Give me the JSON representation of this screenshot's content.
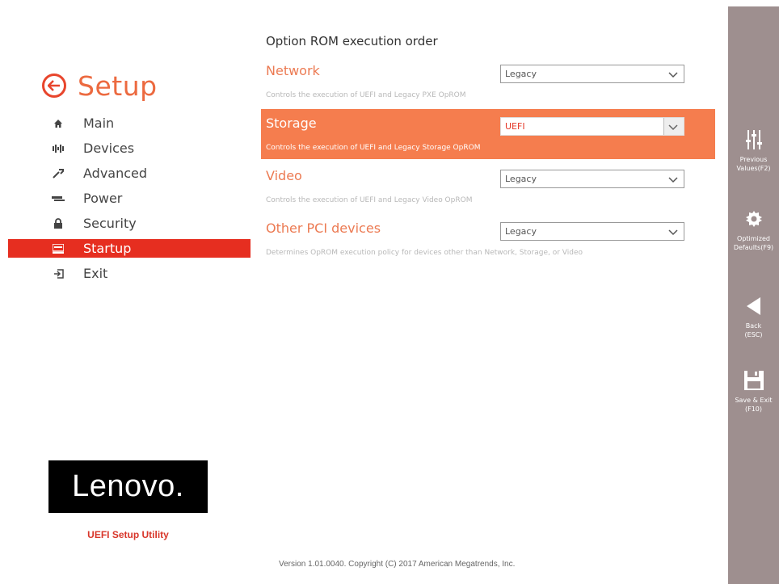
{
  "header": {
    "title": "Setup"
  },
  "nav": {
    "items": [
      {
        "label": "Main",
        "icon": "home-icon"
      },
      {
        "label": "Devices",
        "icon": "devices-icon"
      },
      {
        "label": "Advanced",
        "icon": "wrench-icon"
      },
      {
        "label": "Power",
        "icon": "power-icon"
      },
      {
        "label": "Security",
        "icon": "lock-icon"
      },
      {
        "label": "Startup",
        "icon": "startup-icon",
        "active": true
      },
      {
        "label": "Exit",
        "icon": "exit-icon"
      }
    ]
  },
  "brand": {
    "logo_text": "Lenovo.",
    "utility_label": "UEFI Setup Utility"
  },
  "main": {
    "section_title": "Option ROM execution order",
    "settings": [
      {
        "name": "Network",
        "value": "Legacy",
        "description": "Controls the execution of UEFI and Legacy PXE OpROM"
      },
      {
        "name": "Storage",
        "value": "UEFI",
        "description": "Controls the execution of UEFI and Legacy Storage OpROM",
        "selected": true
      },
      {
        "name": "Video",
        "value": "Legacy",
        "description": "Controls the execution of UEFI and Legacy Video OpROM"
      },
      {
        "name": "Other PCI devices",
        "value": "Legacy",
        "description": "Determines OpROM execution policy for devices other than Network, Storage, or Video"
      }
    ]
  },
  "footer": {
    "version": "Version 1.01.0040. Copyright (C) 2017 American Megatrends, Inc."
  },
  "actions": [
    {
      "label": "Previous\nValues(F2)",
      "icon": "sliders-icon"
    },
    {
      "label": "Optimized\nDefaults(F9)",
      "icon": "gear-icon"
    },
    {
      "label": "Back\n(ESC)",
      "icon": "back-arrow-icon"
    },
    {
      "label": "Save & Exit\n(F10)",
      "icon": "save-icon"
    }
  ],
  "colors": {
    "accent": "#e62e20",
    "selected_row": "#f57d4e",
    "action_bar": "#9e8f8f"
  }
}
